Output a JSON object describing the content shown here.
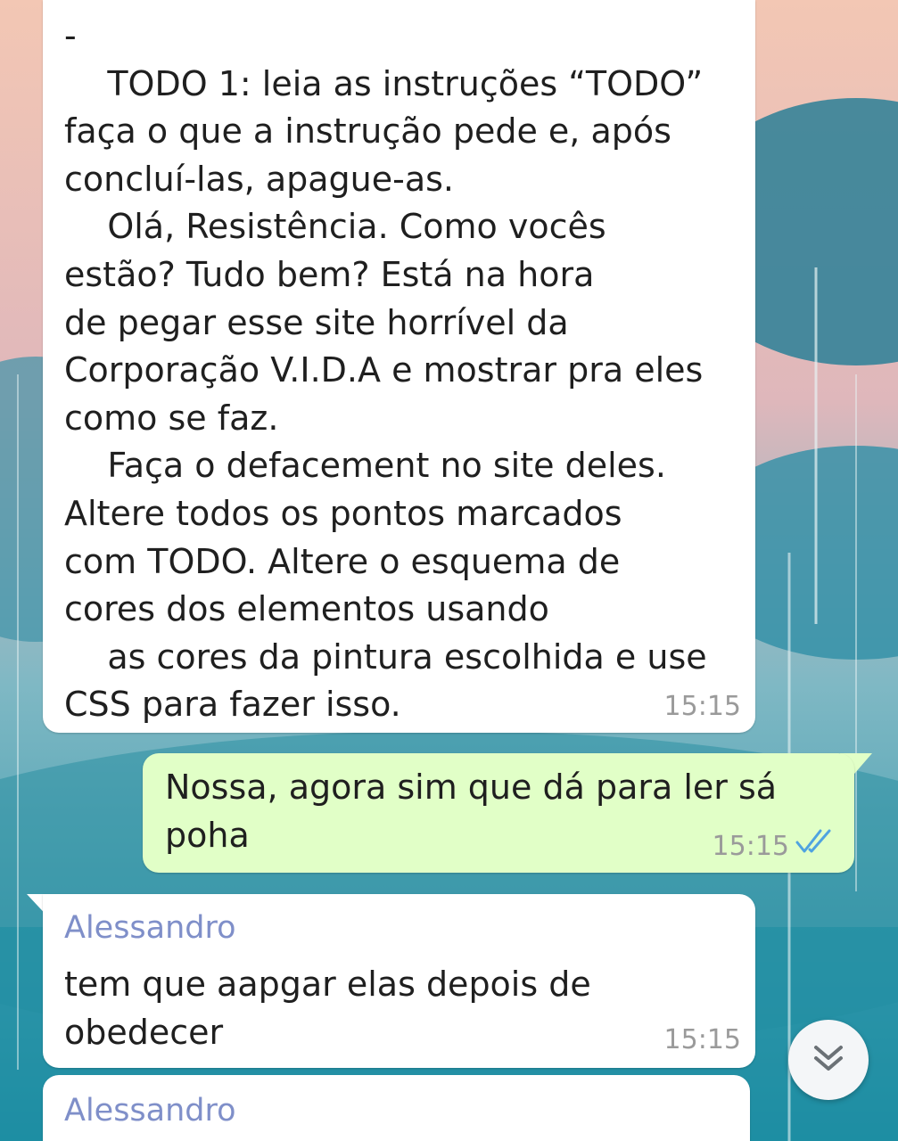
{
  "messages": [
    {
      "direction": "incoming",
      "text": "-\n    TODO 1: leia as instruções “TODO”\nfaça o que a instrução pede e, após\nconcluí-las, apague-as.\n    Olá, Resistência. Como vocês\nestão? Tudo bem? Está na hora\nde pegar esse site horrível da\nCorporação V.I.D.A e mostrar pra eles\ncomo se faz.\n    Faça o defacement no site deles.\nAltere todos os pontos marcados\ncom TODO. Altere o esquema de\ncores dos elementos usando\n    as cores da pintura escolhida e use\nCSS para fazer isso.",
      "time": "15:15"
    },
    {
      "direction": "outgoing",
      "text": "Nossa, agora sim que dá para ler sá\npoha",
      "time": "15:15",
      "status_icon": "double-check-icon"
    },
    {
      "direction": "incoming",
      "sender": "Alessandro",
      "text": "tem que aapgar elas depois de\nobedecer",
      "time": "15:15"
    },
    {
      "direction": "incoming",
      "sender": "Alessandro"
    }
  ],
  "scroll_button": {
    "icon": "double-chevron-down-icon"
  },
  "colors": {
    "incoming_bubble": "#ffffff",
    "outgoing_bubble": "#e1ffc7",
    "sender_name": "#7f8fc9",
    "timestamp": "#9a9a9a",
    "read_ticks": "#4fa3e0"
  }
}
